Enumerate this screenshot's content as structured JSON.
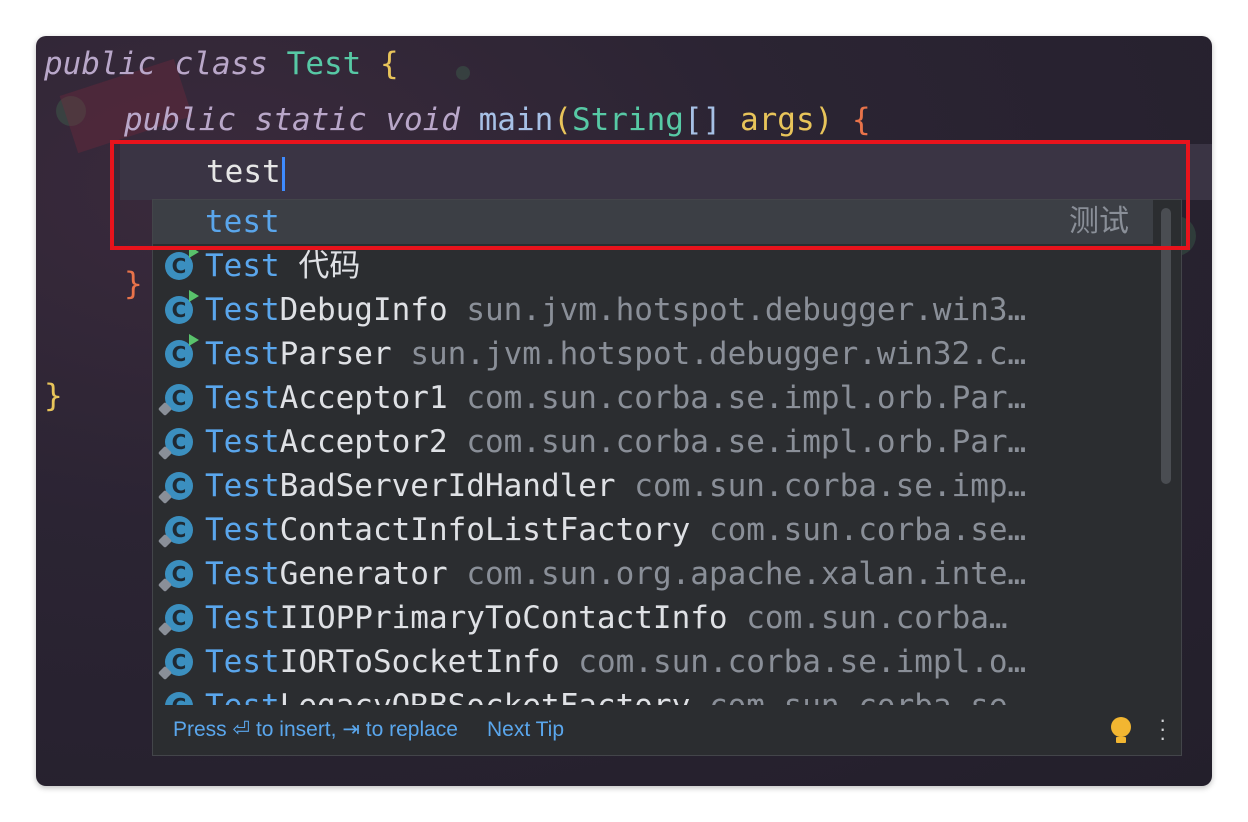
{
  "code": {
    "line1": {
      "kw1": "public",
      "kw2": "class",
      "cls": "Test",
      "brace": "{"
    },
    "line2": {
      "kw1": "public",
      "kw2": "static",
      "kw3": "void",
      "fn": "main",
      "p1": "(",
      "type": "String",
      "arr": "[]",
      "arg": "args",
      "p2": ")",
      "brace": "{"
    },
    "line3": {
      "typed": "test"
    },
    "close_inner": "}",
    "close_outer": "}"
  },
  "popup": {
    "selected": {
      "text": "test",
      "hint": "测试"
    },
    "items": [
      {
        "icon": "class-run-icon",
        "highlight": "Test",
        "rest": " 代码",
        "package": ""
      },
      {
        "icon": "class-run-icon",
        "highlight": "Test",
        "rest": "DebugInfo",
        "package": "sun.jvm.hotspot.debugger.win3…"
      },
      {
        "icon": "class-run-icon",
        "highlight": "Test",
        "rest": "Parser",
        "package": "sun.jvm.hotspot.debugger.win32.c…"
      },
      {
        "icon": "class-lock-icon",
        "highlight": "Test",
        "rest": "Acceptor1",
        "package": "com.sun.corba.se.impl.orb.Par…"
      },
      {
        "icon": "class-lock-icon",
        "highlight": "Test",
        "rest": "Acceptor2",
        "package": "com.sun.corba.se.impl.orb.Par…"
      },
      {
        "icon": "class-lock-icon",
        "highlight": "Test",
        "rest": "BadServerIdHandler",
        "package": "com.sun.corba.se.imp…"
      },
      {
        "icon": "class-lock-icon",
        "highlight": "Test",
        "rest": "ContactInfoListFactory",
        "package": "com.sun.corba.se…"
      },
      {
        "icon": "class-lock-icon",
        "highlight": "Test",
        "rest": "Generator",
        "package": "com.sun.org.apache.xalan.inte…"
      },
      {
        "icon": "class-lock-icon",
        "highlight": "Test",
        "rest": "IIOPPrimaryToContactInfo",
        "package": "com.sun.corba…"
      },
      {
        "icon": "class-lock-icon",
        "highlight": "Test",
        "rest": "IORToSocketInfo",
        "package": "com.sun.corba.se.impl.o…"
      },
      {
        "icon": "class-lock-icon",
        "highlight": "Test",
        "rest": "LegacyORBSocketFactory",
        "package": "com.sun.corba.se…"
      }
    ],
    "footer": {
      "press": "Press ⏎ to insert, ⇥ to replace",
      "tip": "Next Tip"
    },
    "icon_letter": "C"
  },
  "colors": {
    "accent": "#5aa6ec",
    "highlight_box": "#e8131c"
  }
}
